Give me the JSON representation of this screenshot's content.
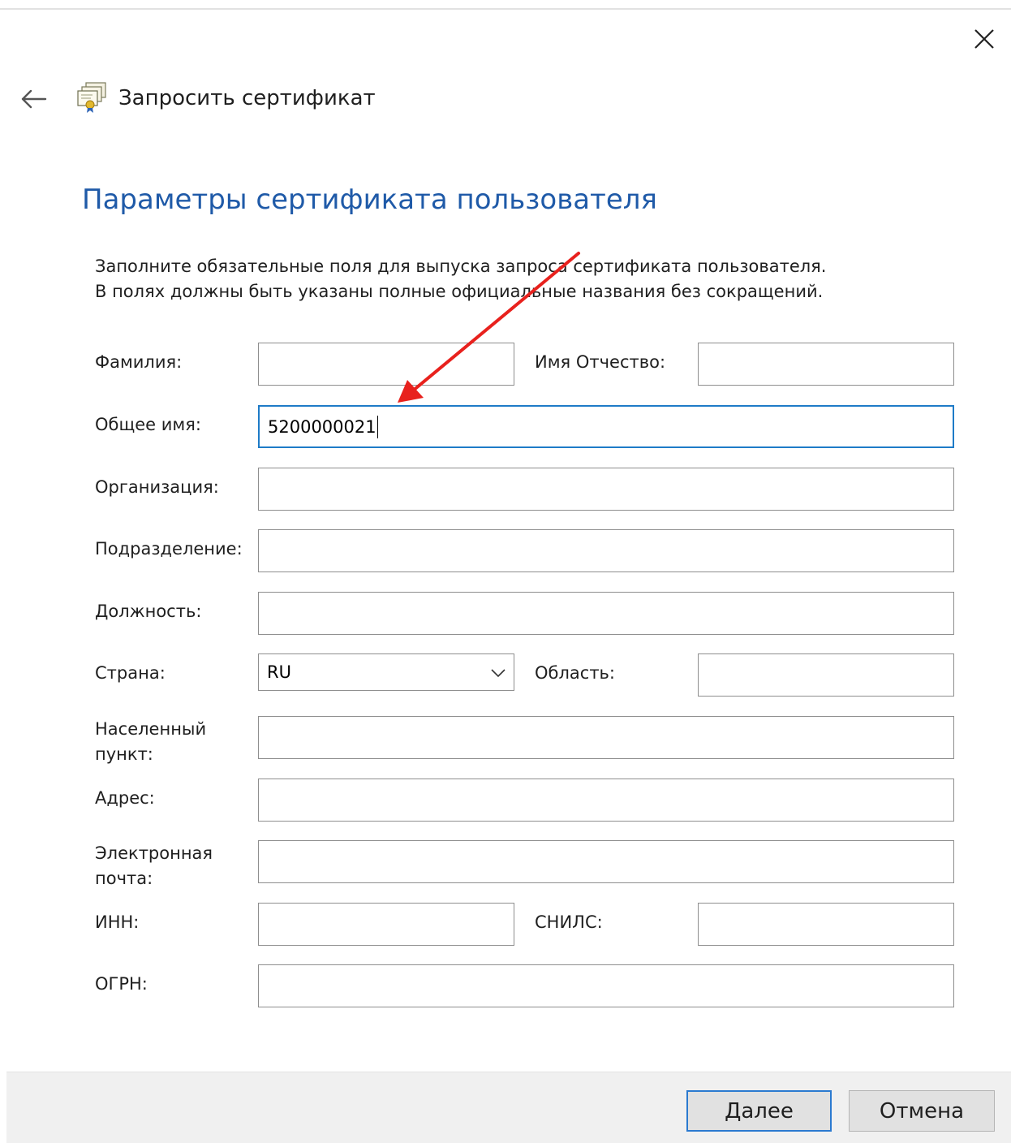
{
  "window": {
    "title": "Запросить сертификат"
  },
  "page": {
    "title": "Параметры сертификата пользователя",
    "description_line1": "Заполните обязательные поля для выпуска запроса сертификата пользователя.",
    "description_line2": "В полях должны быть указаны полные официальные названия без сокращений."
  },
  "form": {
    "surname": {
      "label": "Фамилия:",
      "value": ""
    },
    "name_patronymic": {
      "label": "Имя Отчество:",
      "value": ""
    },
    "common_name": {
      "label": "Общее имя:",
      "value": "5200000021"
    },
    "organization": {
      "label": "Организация:",
      "value": ""
    },
    "department": {
      "label": "Подразделение:",
      "value": ""
    },
    "position": {
      "label": "Должность:",
      "value": ""
    },
    "country": {
      "label": "Страна:",
      "value": "RU"
    },
    "region": {
      "label": "Область:",
      "value": ""
    },
    "locality": {
      "label_line1": "Населенный",
      "label_line2": "пункт:",
      "value": ""
    },
    "address": {
      "label": "Адрес:",
      "value": ""
    },
    "email": {
      "label_line1": "Электронная",
      "label_line2": "почта:",
      "value": ""
    },
    "inn": {
      "label": "ИНН:",
      "value": ""
    },
    "snils": {
      "label": "СНИЛС:",
      "value": ""
    },
    "ogrn": {
      "label": "ОГРН:",
      "value": ""
    }
  },
  "buttons": {
    "next": "Далее",
    "cancel": "Отмена"
  },
  "colors": {
    "title_blue": "#1f5aa8",
    "focus_border": "#1e7bc7",
    "annotation_arrow": "#e8211d"
  },
  "icons": {
    "back": "back-arrow-icon",
    "close": "close-icon",
    "certificate": "certificate-icon",
    "dropdown": "chevron-down-icon"
  }
}
